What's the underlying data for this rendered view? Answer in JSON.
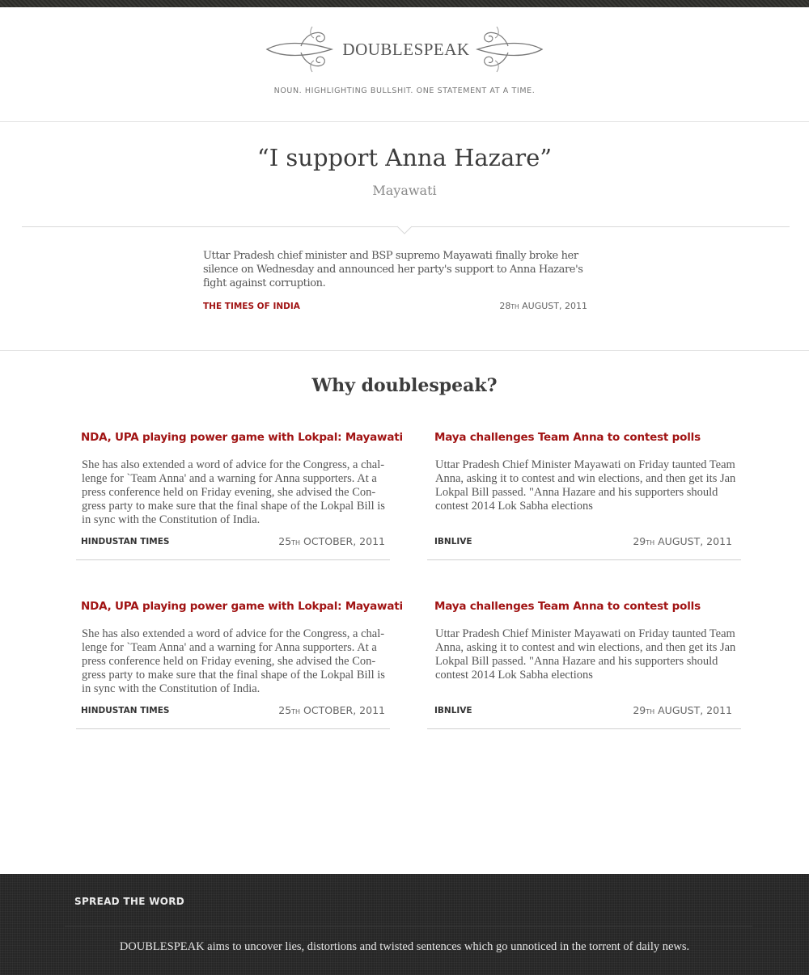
{
  "site": {
    "title": "DOUBLESPEAK",
    "tagline": "NOUN. HIGHLIGHTING BULLSHIT. ONE STATEMENT AT A TIME."
  },
  "featured": {
    "quote": "“I support Anna Hazare”",
    "speaker": "Mayawati",
    "body": "Uttar Pradesh chief minister and BSP supremo Mayawati finally broke her silence on Wednesday and announced her  party's support to Anna Hazare's fight against corruption.",
    "source": "THE TIMES OF INDIA",
    "date_day": "28",
    "date_suffix": "TH",
    "date_rest": " AUGUST, 2011"
  },
  "why": {
    "heading": "Why doublespeak?",
    "cards": [
      {
        "title": "NDA, UPA playing power game with Lokpal: Mayawati",
        "body": "She has also extended a word of advice for the Congress, a chal-lenge for `Team Anna' and a warning for Anna supporters. At a press conference held on Friday evening, she advised the Con-gress party to make sure that the final shape of the Lokpal Bill is in sync with the Constitution of India.",
        "source": "HINDUSTAN TIMES",
        "date_day": "25",
        "date_suffix": "TH",
        "date_rest": " OCTOBER, 2011"
      },
      {
        "title": "Maya challenges Team Anna to contest polls",
        "body": "Uttar Pradesh Chief Minister Mayawati on Friday taunted Team Anna, asking it to contest and win elections, and then get its Jan Lokpal Bill passed. \"Anna Hazare and his supporters should contest 2014 Lok Sabha elections",
        "source": "IBNLIVE",
        "date_day": "29",
        "date_suffix": "TH",
        "date_rest": " AUGUST, 2011"
      },
      {
        "title": "NDA, UPA playing power game with Lokpal: Mayawati",
        "body": "She has also extended a word of advice for the Congress, a chal-lenge for `Team Anna' and a warning for Anna supporters. At a press conference held on Friday evening, she advised the Con-gress party to make sure that the final shape of the Lokpal Bill is in sync with the Constitution of India.",
        "source": "HINDUSTAN TIMES",
        "date_day": "25",
        "date_suffix": "TH",
        "date_rest": " OCTOBER, 2011"
      },
      {
        "title": "Maya challenges Team Anna to contest polls",
        "body": "Uttar Pradesh Chief Minister Mayawati on Friday taunted Team Anna, asking it to contest and win elections, and then get its Jan Lokpal Bill passed. \"Anna Hazare and his supporters should contest 2014 Lok Sabha elections",
        "source": "IBNLIVE",
        "date_day": "29",
        "date_suffix": "TH",
        "date_rest": " AUGUST, 2011"
      }
    ]
  },
  "footer": {
    "heading": "SPREAD THE WORD",
    "text": "DOUBLESPEAK aims to uncover lies, distortions and twisted sentences which go unnoticed in the torrent of daily news."
  },
  "colors": {
    "accent_red": "#a11414",
    "footer_bg": "#262626"
  }
}
